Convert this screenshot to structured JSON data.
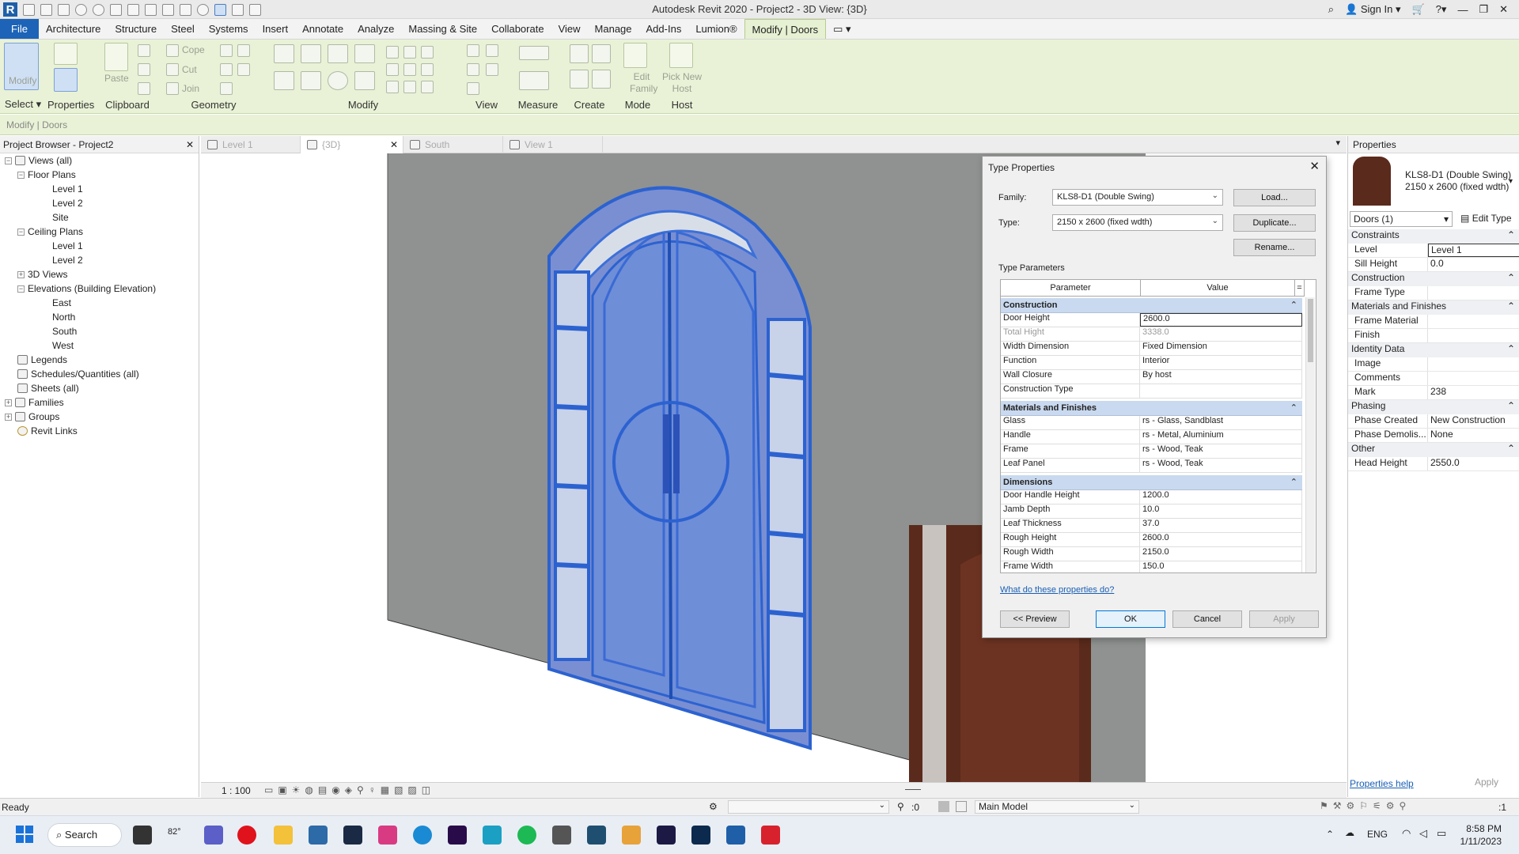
{
  "app": {
    "title": "Autodesk Revit 2020 - Project2 - 3D View: {3D}",
    "sign_in": "Sign In"
  },
  "menu": {
    "tabs": [
      "File",
      "Architecture",
      "Structure",
      "Steel",
      "Systems",
      "Insert",
      "Annotate",
      "Analyze",
      "Massing & Site",
      "Collaborate",
      "View",
      "Manage",
      "Add-Ins",
      "Lumion®",
      "Modify | Doors"
    ]
  },
  "ribbon": {
    "panels": [
      "Select",
      "Properties",
      "Clipboard",
      "Geometry",
      "Modify",
      "View",
      "Measure",
      "Create",
      "Mode",
      "Host"
    ],
    "buttons": {
      "modify": "Modify",
      "paste": "Paste",
      "cope": "Cope",
      "cut": "Cut",
      "join": "Join",
      "edit_family": "Edit Family",
      "pick_new_host": "Pick New Host"
    }
  },
  "context_bar": "Modify | Doors",
  "project_browser": {
    "title": "Project Browser - Project2",
    "items": [
      "Views (all)",
      "Floor Plans",
      "Level 1",
      "Level 2",
      "Site",
      "Ceiling Plans",
      "Level 1",
      "Level 2",
      "3D Views",
      "Elevations (Building Elevation)",
      "East",
      "North",
      "South",
      "West",
      "Legends",
      "Schedules/Quantities (all)",
      "Sheets (all)",
      "Families",
      "Groups",
      "Revit Links"
    ]
  },
  "view_tabs": [
    "Level 1",
    "{3D}",
    "South",
    "View 1"
  ],
  "view_control": {
    "scale": "1 : 100"
  },
  "properties_panel": {
    "title": "Properties",
    "type_name": "KLS8-D1 (Double Swing)",
    "type_size": "2150 x 2600 (fixed wdth)",
    "selector": "Doors (1)",
    "edit_type": "Edit Type",
    "groups": {
      "constraints": "Constraints",
      "construction": "Construction",
      "materials": "Materials and Finishes",
      "identity": "Identity Data",
      "phasing": "Phasing",
      "other": "Other"
    },
    "rows": {
      "level": [
        "Level",
        "Level 1"
      ],
      "sill_height": [
        "Sill Height",
        "0.0"
      ],
      "frame_type": [
        "Frame Type",
        ""
      ],
      "frame_material": [
        "Frame Material",
        ""
      ],
      "finish": [
        "Finish",
        ""
      ],
      "image": [
        "Image",
        ""
      ],
      "comments": [
        "Comments",
        ""
      ],
      "mark": [
        "Mark",
        "238"
      ],
      "phase_created": [
        "Phase Created",
        "New Construction"
      ],
      "phase_demolished": [
        "Phase Demolis...",
        "None"
      ],
      "head_height": [
        "Head Height",
        "2550.0"
      ]
    },
    "help_link": "Properties help",
    "apply": "Apply"
  },
  "dialog": {
    "title": "Type Properties",
    "family_label": "Family:",
    "family_value": "KLS8-D1 (Double Swing)",
    "type_label": "Type:",
    "type_value": "2150 x 2600 (fixed wdth)",
    "load": "Load...",
    "duplicate": "Duplicate...",
    "rename": "Rename...",
    "type_parameters": "Type Parameters",
    "col_parameter": "Parameter",
    "col_value": "Value",
    "col_eq": "=",
    "groups": {
      "construction": "Construction",
      "materials": "Materials and Finishes",
      "dimensions": "Dimensions"
    },
    "construction_rows": [
      [
        "Door Height",
        "2600.0"
      ],
      [
        "Total Hight",
        "3338.0"
      ],
      [
        "Width Dimension",
        "Fixed Dimension"
      ],
      [
        "Function",
        "Interior"
      ],
      [
        "Wall Closure",
        "By host"
      ],
      [
        "Construction Type",
        ""
      ]
    ],
    "materials_rows": [
      [
        "Glass",
        "rs - Glass, Sandblast"
      ],
      [
        "Handle",
        "rs - Metal, Aluminium"
      ],
      [
        "Frame",
        "rs - Wood, Teak"
      ],
      [
        "Leaf Panel",
        "rs - Wood, Teak"
      ]
    ],
    "dimensions_rows": [
      [
        "Door Handle Height",
        "1200.0"
      ],
      [
        "Jamb Depth",
        "10.0"
      ],
      [
        "Leaf Thickness",
        "37.0"
      ],
      [
        "Rough Height",
        "2600.0"
      ],
      [
        "Rough Width",
        "2150.0"
      ],
      [
        "Frame Width",
        "150.0"
      ]
    ],
    "help_link": "What do these properties do?",
    "preview": "<< Preview",
    "ok": "OK",
    "cancel": "Cancel",
    "apply": "Apply"
  },
  "status": {
    "text": "Ready",
    "workset_count": ":0",
    "model": "Main Model",
    "filter_count": ":1"
  },
  "taskbar": {
    "search": "Search",
    "temp": "82°",
    "lang": "ENG",
    "time": "8:58 PM",
    "date": "1/11/2023"
  },
  "colors": {
    "accent": "#1d63b7",
    "ribbon_bg": "#e9f2d6",
    "selection_blue": "#6f8ed8",
    "dialog_group": "#c9d9ef"
  }
}
